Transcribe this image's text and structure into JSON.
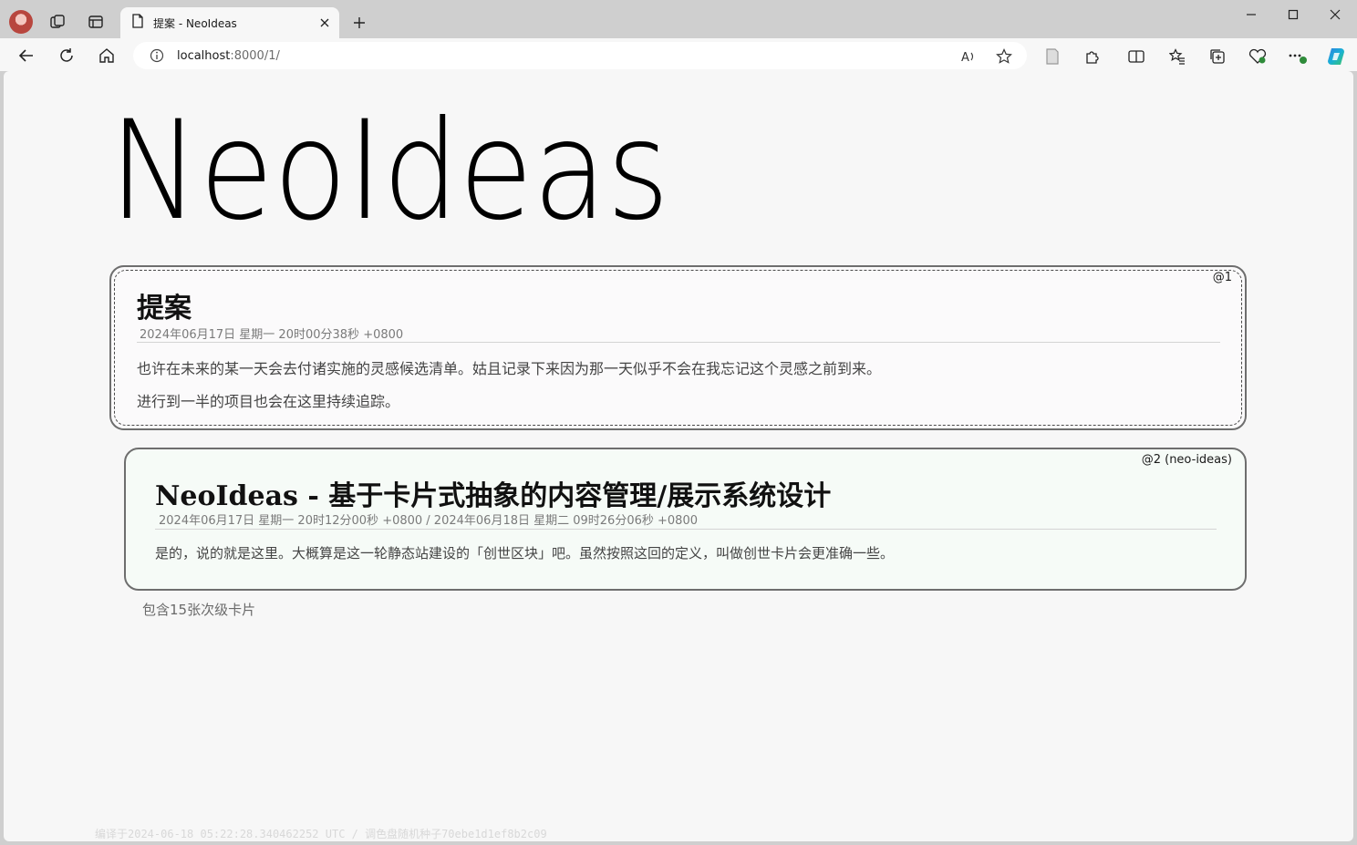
{
  "browser": {
    "tab_title": "提案 - NeoIdeas",
    "url_host": "localhost",
    "url_rest": ":8000/1/"
  },
  "page": {
    "logo_text": "NeoIdeas",
    "card1": {
      "id": "@1",
      "title": "提案",
      "date": "2024年06月17日 星期一 20时00分38秒 +0800",
      "paragraphs": [
        "也许在未来的某一天会去付诸实施的灵感候选清单。姑且记录下来因为那一天似乎不会在我忘记这个灵感之前到来。",
        "进行到一半的项目也会在这里持续追踪。"
      ]
    },
    "card2": {
      "id": "@2 (neo-ideas)",
      "title_bold": "NeoIdeas -",
      "title_rest": " 基于卡片式抽象的内容管理/展示系统设计",
      "date": "2024年06月17日 星期一 20时12分00秒 +0800 / 2024年06月18日 星期二 09时26分06秒 +0800",
      "paragraph": "是的，说的就是这里。大概算是这一轮静态站建设的「创世区块」吧。虽然按照这回的定义，叫做创世卡片会更准确一些。"
    },
    "children_count_text": "包含15张次级卡片",
    "footer_text": "编译于2024-06-18 05:22:28.340462252 UTC / 调色盘随机种子70ebe1d1ef8b2c09"
  }
}
